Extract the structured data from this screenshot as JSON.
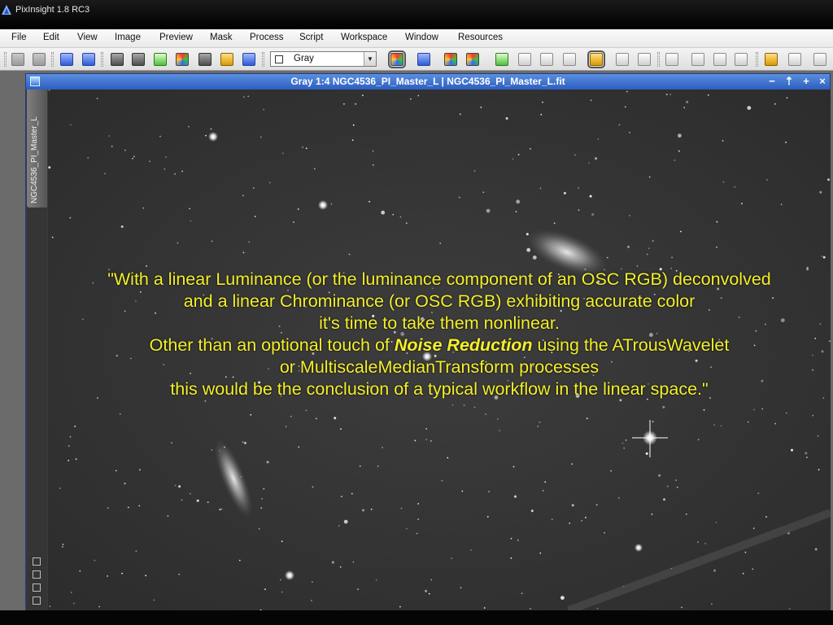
{
  "window": {
    "title": "PixInsight 1.8 RC3"
  },
  "menu": [
    "File",
    "Edit",
    "View",
    "Image",
    "Preview",
    "Mask",
    "Process",
    "Script",
    "Workspace",
    "Window",
    "Resources"
  ],
  "toolbar": {
    "colorspace_value": "Gray"
  },
  "image_window": {
    "title": "Gray 1:4 NGC4536_PI_Master_L | NGC4536_PI_Master_L.fit",
    "view_tab_label": "NGC4536_PI_Master_L",
    "controls": [
      "−",
      "⇡",
      "+",
      "×"
    ]
  },
  "caption": {
    "line1": "\"With a linear Luminance (or the luminance component of an OSC RGB) deconvolved",
    "line2": "and a linear Chrominance (or OSC RGB) exhibiting accurate color",
    "line3": "it's time to take them nonlinear.",
    "line4_pre": "Other than an optional touch of ",
    "line4_emph": "Noise Reduction",
    "line4_post": " using the ATrousWavelet",
    "line5": "or MultiscaleMedianTransform processes",
    "line6": "this would be the conclusion of a typical workflow in the linear space.\""
  },
  "colors": {
    "caption_text": "#f4f02a",
    "window_title_bar": "#2c5ec0",
    "sky_background": "#333333"
  }
}
